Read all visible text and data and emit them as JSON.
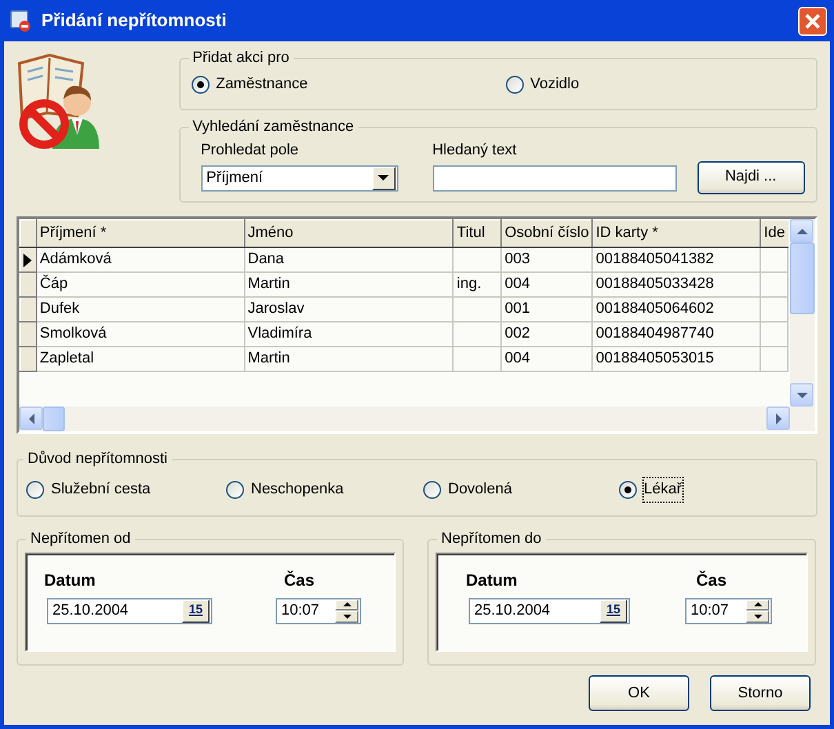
{
  "window": {
    "title": "Přidání nepřítomnosti"
  },
  "action_for": {
    "label": "Přidat akci pro",
    "options": [
      {
        "label": "Zaměstnance",
        "selected": true
      },
      {
        "label": "Vozidlo",
        "selected": false
      }
    ]
  },
  "employee_search": {
    "label": "Vyhledání zaměstnance",
    "field_label": "Prohledat pole",
    "field_value": "Příjmení",
    "text_label": "Hledaný text",
    "button": "Najdi ..."
  },
  "table": {
    "columns": [
      "Příjmení *",
      "Jméno",
      "Titul",
      "Osobní číslo",
      "ID karty *",
      "Ide"
    ],
    "rows": [
      {
        "selected": true,
        "cells": [
          "Adámková",
          "Dana",
          null,
          "003",
          "00188405041382",
          null
        ]
      },
      {
        "selected": false,
        "cells": [
          "Čáp",
          "Martin",
          "ing.",
          "004",
          "00188405033428",
          null
        ]
      },
      {
        "selected": false,
        "cells": [
          "Dufek",
          "Jaroslav",
          null,
          "001",
          "00188405064602",
          null
        ]
      },
      {
        "selected": false,
        "cells": [
          "Smolková",
          "Vladimíra",
          null,
          "002",
          "00188404987740",
          null
        ]
      },
      {
        "selected": false,
        "cells": [
          "Zapletal",
          "Martin",
          null,
          "004",
          "00188405053015",
          null
        ]
      }
    ]
  },
  "reason": {
    "label": "Důvod nepřítomnosti",
    "options": [
      {
        "label": "Služební cesta",
        "selected": false
      },
      {
        "label": "Neschopenka",
        "selected": false
      },
      {
        "label": "Dovolená",
        "selected": false
      },
      {
        "label": "Lékař",
        "selected": true
      }
    ]
  },
  "absent_from": {
    "label": "Nepřítomen od",
    "date_label": "Datum",
    "date": "25.10.2004",
    "calendar": "15",
    "time_label": "Čas",
    "time": "10:07"
  },
  "absent_to": {
    "label": "Nepřítomen do",
    "date_label": "Datum",
    "date": "25.10.2004",
    "calendar": "15",
    "time_label": "Čas",
    "time": "10:07"
  },
  "buttons": [
    "OK",
    "Storno"
  ]
}
